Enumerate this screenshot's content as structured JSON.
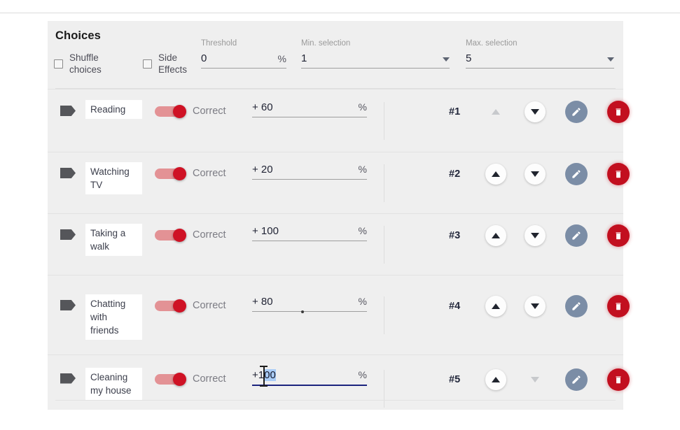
{
  "panel": {
    "title": "Choices",
    "checkboxes": [
      {
        "id": "shuffle-choices",
        "label": "Shuffle choices",
        "checked": false
      },
      {
        "id": "side-effects",
        "label": "Side Effects",
        "checked": false
      }
    ],
    "fields": [
      {
        "id": "threshold",
        "label": "Threshold",
        "value": "0",
        "suffix": "%",
        "type": "text"
      },
      {
        "id": "min-selection",
        "label": "Min. selection",
        "value": "1",
        "suffix": "",
        "type": "select"
      },
      {
        "id": "max-selection",
        "label": "Max. selection",
        "value": "5",
        "suffix": "",
        "type": "select"
      }
    ]
  },
  "columns": {
    "score_suffix": "%",
    "toggle_label": "Correct"
  },
  "rows": [
    {
      "tag_icon": "tag-icon",
      "name": "Reading",
      "toggle_on": true,
      "toggle_label": "Correct",
      "score": "+ 60",
      "score_suffix": "%",
      "rank": "#1",
      "up_enabled": false,
      "down_enabled": true,
      "focused": false,
      "hover_dot": false,
      "edit_icon": "pencil-icon",
      "delete_icon": "trash-icon"
    },
    {
      "tag_icon": "tag-icon",
      "name": "Watching TV",
      "toggle_on": true,
      "toggle_label": "Correct",
      "score": "+ 20",
      "score_suffix": "%",
      "rank": "#2",
      "up_enabled": true,
      "down_enabled": true,
      "focused": false,
      "hover_dot": false,
      "edit_icon": "pencil-icon",
      "delete_icon": "trash-icon"
    },
    {
      "tag_icon": "tag-icon",
      "name": "Taking a walk",
      "toggle_on": true,
      "toggle_label": "Correct",
      "score": "+ 100",
      "score_suffix": "%",
      "rank": "#3",
      "up_enabled": true,
      "down_enabled": true,
      "focused": false,
      "hover_dot": false,
      "edit_icon": "pencil-icon",
      "delete_icon": "trash-icon"
    },
    {
      "tag_icon": "tag-icon",
      "name": "Chatting with friends",
      "toggle_on": true,
      "toggle_label": "Correct",
      "score": "+ 80",
      "score_suffix": "%",
      "rank": "#4",
      "up_enabled": true,
      "down_enabled": true,
      "focused": false,
      "hover_dot": true,
      "edit_icon": "pencil-icon",
      "delete_icon": "trash-icon"
    },
    {
      "tag_icon": "tag-icon",
      "name": "Cleaning my house",
      "toggle_on": true,
      "toggle_label": "Correct",
      "score": "+100",
      "score_prefix": "+1",
      "score_selected": "00",
      "score_suffix": "%",
      "rank": "#5",
      "up_enabled": true,
      "down_enabled": false,
      "focused": true,
      "hover_dot": false,
      "edit_icon": "pencil-icon",
      "delete_icon": "trash-icon"
    }
  ],
  "colors": {
    "panel_bg": "#efefef",
    "toggle_on": "#cf1225",
    "toggle_track": "#e39295",
    "edit_button": "#7b8da6",
    "delete_button": "#c20f1f",
    "focus_underline": "#1a237e",
    "selection": "#aacdf7",
    "tag": "#55565a"
  }
}
